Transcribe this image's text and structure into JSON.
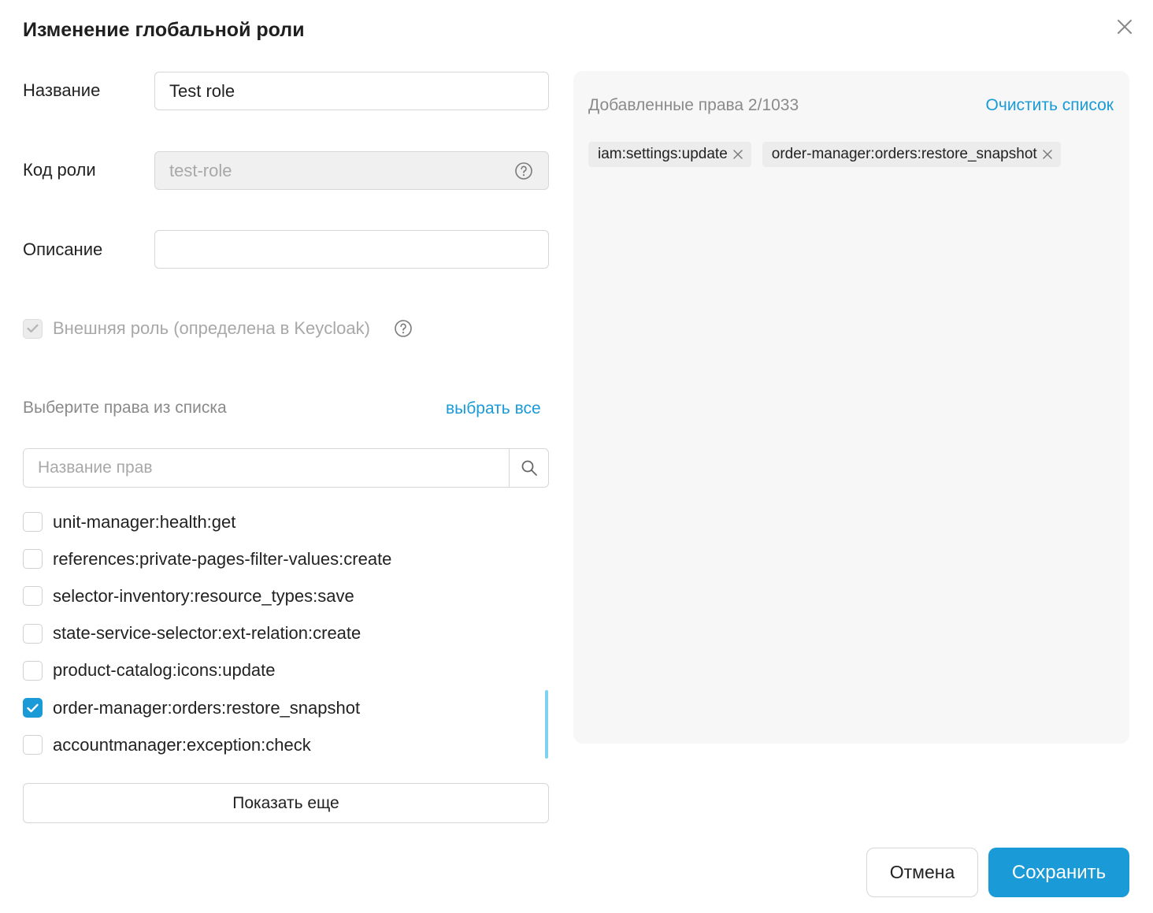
{
  "dialog": {
    "title": "Изменение глобальной роли"
  },
  "form": {
    "name_label": "Название",
    "name_value": "Test role",
    "code_label": "Код роли",
    "code_value": "test-role",
    "description_label": "Описание",
    "description_value": "",
    "external_role_label": "Внешняя роль (определена в Keycloak)",
    "external_role_checked": true
  },
  "permissions": {
    "section_label": "Выберите права из списка",
    "select_all_label": "выбрать все",
    "search_placeholder": "Название прав",
    "items": [
      {
        "label": "unit-manager:health:get",
        "checked": false
      },
      {
        "label": "references:private-pages-filter-values:create",
        "checked": false
      },
      {
        "label": "selector-inventory:resource_types:save",
        "checked": false
      },
      {
        "label": "state-service-selector:ext-relation:create",
        "checked": false
      },
      {
        "label": "product-catalog:icons:update",
        "checked": false
      },
      {
        "label": "order-manager:orders:restore_snapshot",
        "checked": true
      },
      {
        "label": "accountmanager:exception:check",
        "checked": false
      }
    ],
    "show_more_label": "Показать еще"
  },
  "added_panel": {
    "title": "Добавленные права 2/1033",
    "clear_label": "Очистить список",
    "chips": [
      "iam:settings:update",
      "order-manager:orders:restore_snapshot"
    ]
  },
  "footer": {
    "cancel_label": "Отмена",
    "save_label": "Сохранить"
  },
  "colors": {
    "accent": "#1a9bd7",
    "scrollbar": "#7fd2f0"
  }
}
